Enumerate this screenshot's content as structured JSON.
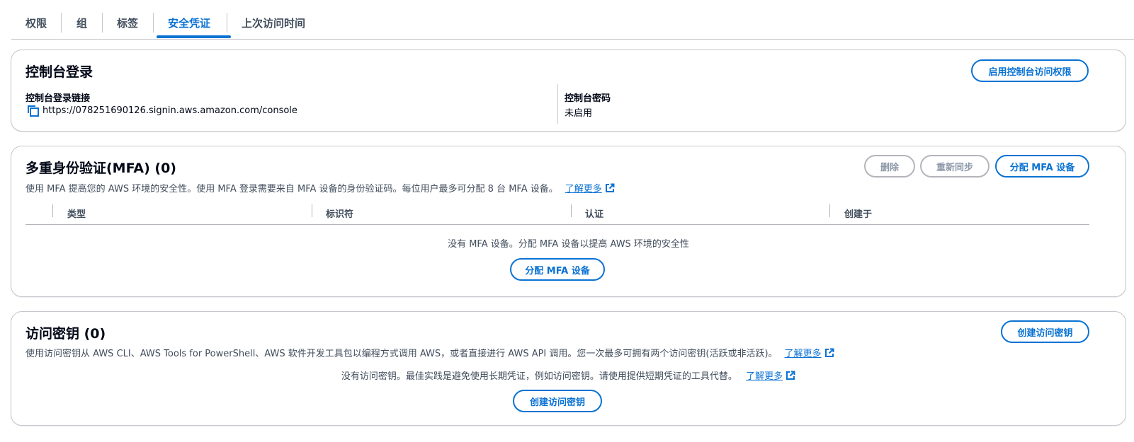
{
  "tabs": [
    {
      "label": "权限"
    },
    {
      "label": "组"
    },
    {
      "label": "标签"
    },
    {
      "label": "安全凭证"
    },
    {
      "label": "上次访问时间"
    }
  ],
  "active_tab": "安全凭证",
  "console": {
    "title": "控制台登录",
    "enable_button": "启用控制台访问权限",
    "link_label": "控制台登录链接",
    "link_value": "https://078251690126.signin.aws.amazon.com/console",
    "password_label": "控制台密码",
    "password_value": "未启用"
  },
  "mfa": {
    "title": "多重身份验证(MFA) (0)",
    "delete_button": "删除",
    "resync_button": "重新同步",
    "assign_button": "分配 MFA 设备",
    "description": "使用 MFA 提高您的 AWS 环境的安全性。使用 MFA 登录需要来自 MFA 设备的身份验证码。每位用户最多可分配 8 台 MFA 设备。",
    "learn_more": "了解更多",
    "columns": [
      "类型",
      "标识符",
      "认证",
      "创建于"
    ],
    "empty_text": "没有 MFA 设备。分配 MFA 设备以提高 AWS 环境的安全性",
    "empty_button": "分配 MFA 设备"
  },
  "access_keys": {
    "title": "访问密钥 (0)",
    "create_button": "创建访问密钥",
    "description": "使用访问密钥从 AWS CLI、AWS Tools for PowerShell、AWS 软件开发工具包以编程方式调用 AWS，或者直接进行 AWS API 调用。您一次最多可拥有两个访问密钥(活跃或非活跃)。",
    "learn_more": "了解更多",
    "empty_text": "没有访问密钥。最佳实践是避免使用长期凭证，例如访问密钥。请使用提供短期凭证的工具代替。",
    "empty_learn_more": "了解更多",
    "empty_button": "创建访问密钥"
  },
  "colors": {
    "accent": "#0972d3",
    "border": "#c6c6cd",
    "disabled": "#8d99a8",
    "text": "#000716"
  }
}
